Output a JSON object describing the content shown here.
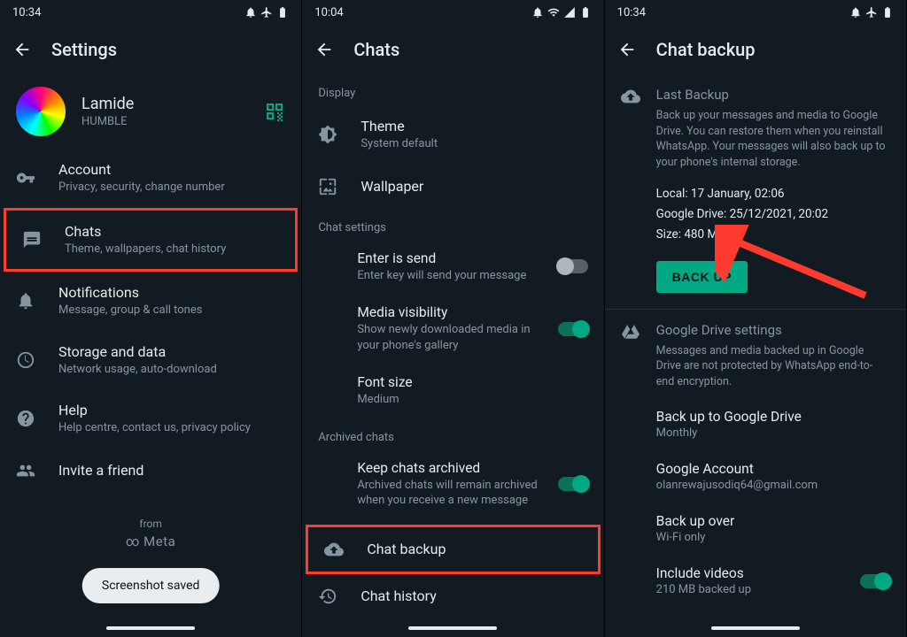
{
  "pane1": {
    "time": "10:34",
    "title": "Settings",
    "profile": {
      "name": "Lamide",
      "status": "HUMBLE"
    },
    "items": [
      {
        "title": "Account",
        "sub": "Privacy, security, change number"
      },
      {
        "title": "Chats",
        "sub": "Theme, wallpapers, chat history"
      },
      {
        "title": "Notifications",
        "sub": "Message, group & call tones"
      },
      {
        "title": "Storage and data",
        "sub": "Network usage, auto-download"
      },
      {
        "title": "Help",
        "sub": "Help centre, contact us, privacy policy"
      },
      {
        "title": "Invite a friend",
        "sub": ""
      }
    ],
    "from": "from",
    "meta": "Meta",
    "toast": "Screenshot saved"
  },
  "pane2": {
    "time": "10:04",
    "title": "Chats",
    "displayHeader": "Display",
    "theme": {
      "title": "Theme",
      "sub": "System default"
    },
    "wallpaper": {
      "title": "Wallpaper"
    },
    "chatSettingsHeader": "Chat settings",
    "enterSend": {
      "title": "Enter is send",
      "sub": "Enter key will send your message"
    },
    "mediaVis": {
      "title": "Media visibility",
      "sub": "Show newly downloaded media in your phone's gallery"
    },
    "fontSize": {
      "title": "Font size",
      "sub": "Medium"
    },
    "archivedHeader": "Archived chats",
    "keepArchived": {
      "title": "Keep chats archived",
      "sub": "Archived chats will remain archived when you receive a new message"
    },
    "chatBackup": {
      "title": "Chat backup"
    },
    "chatHistory": {
      "title": "Chat history"
    }
  },
  "pane3": {
    "time": "10:34",
    "title": "Chat backup",
    "lastBackupHeader": "Last Backup",
    "desc": "Back up your messages and media to Google Drive. You can restore them when you reinstall WhatsApp. Your messages will also back up to your phone's internal storage.",
    "local": "Local: 17 January, 02:06",
    "gdrive": "Google Drive: 25/12/2021, 20:02",
    "size": "Size: 480 MB",
    "backupBtn": "BACK UP",
    "gdHeader": "Google Drive settings",
    "gdDesc": "Messages and media backed up in Google Drive are not protected by WhatsApp end-to-end encryption.",
    "backupTo": {
      "title": "Back up to Google Drive",
      "sub": "Monthly"
    },
    "account": {
      "title": "Google Account",
      "sub": "olanrewajusodiq64@gmail.com"
    },
    "backupOver": {
      "title": "Back up over",
      "sub": "Wi-Fi only"
    },
    "includeVideos": {
      "title": "Include videos",
      "sub": "210 MB backed up"
    }
  }
}
